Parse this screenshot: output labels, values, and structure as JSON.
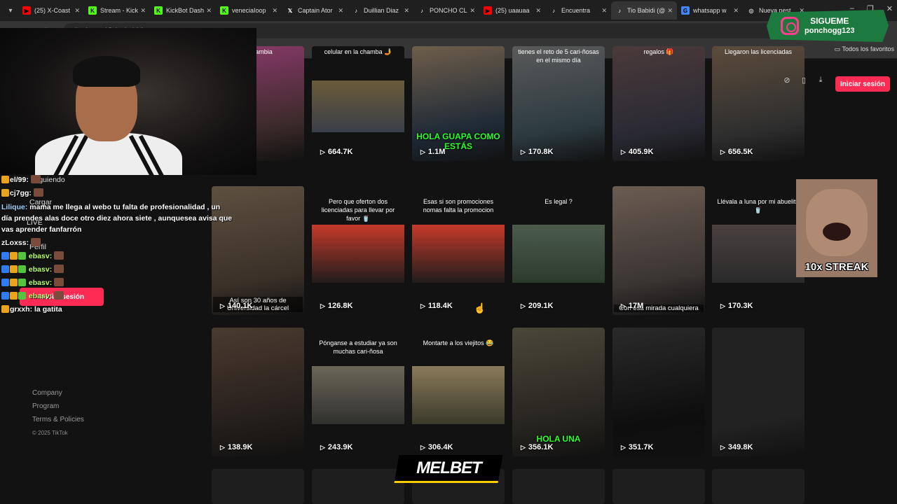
{
  "browser": {
    "tabs": [
      {
        "label": "(25) X-Coast",
        "icon": "youtube-icon",
        "color": "#ff0000"
      },
      {
        "label": "Stream - Kick",
        "icon": "kick-icon",
        "color": "#53fc18"
      },
      {
        "label": "KickBot Dash",
        "icon": "kick-icon",
        "color": "#53fc18"
      },
      {
        "label": "veneciaIoop",
        "icon": "kick-icon",
        "color": "#53fc18"
      },
      {
        "label": "Captain Ator",
        "icon": "x-icon",
        "color": "#ffffff"
      },
      {
        "label": "Duillian Diaz",
        "icon": "tiktok-icon",
        "color": "#ffffff"
      },
      {
        "label": "PONCHO CL",
        "icon": "tiktok-icon",
        "color": "#ffffff"
      },
      {
        "label": "(25) uaauaa",
        "icon": "youtube-icon",
        "color": "#ff0000"
      },
      {
        "label": "Encuentra",
        "icon": "tiktok-icon",
        "color": "#ffffff"
      },
      {
        "label": "Tio Babidi (@",
        "icon": "tiktok-icon",
        "color": "#ffffff"
      },
      {
        "label": "whatsapp w",
        "icon": "google-icon",
        "color": "#4285f4"
      },
      {
        "label": "Nueva pest",
        "icon": "globe-icon",
        "color": "#cccccc"
      }
    ],
    "url": "tiktok.com/@tio_babidi",
    "bookmarks_all": "Todos los favoritos"
  },
  "site": {
    "login_button": "Iniciar sesión",
    "footer_links": [
      "Company",
      "Program",
      "Terms & Policies"
    ],
    "copyright": "© 2025 TikTok"
  },
  "videos": [
    {
      "views": "",
      "caption": "no cambia",
      "overlay": "",
      "sub": ""
    },
    {
      "views": "664.7K",
      "caption": "celular en la chamba 🤳",
      "overlay": "",
      "sub": ""
    },
    {
      "views": "1.1M",
      "caption": "",
      "overlay": "HOLA GUAPA COMO ESTÁS",
      "sub": ""
    },
    {
      "views": "170.8K",
      "caption": "tienes el reto de 5 cari-ñosas en el mismo día",
      "overlay": "",
      "sub": ""
    },
    {
      "views": "405.9K",
      "caption": "regalos 🎁",
      "overlay": "",
      "sub": ""
    },
    {
      "views": "656.5K",
      "caption": "Llegaron las licenciadas",
      "overlay": "",
      "sub": ""
    },
    {
      "views": "140.1K",
      "caption": "",
      "overlay": "",
      "sub": "Así son 30 años de Universidad la cárcel"
    },
    {
      "views": "126.8K",
      "caption": "Pero que oferton dos licenciadas para llevar por favor 🥤",
      "overlay": "",
      "sub": ""
    },
    {
      "views": "118.4K",
      "caption": "Esas si son promociones nomas falta la promocion",
      "overlay": "",
      "sub": ""
    },
    {
      "views": "209.1K",
      "caption": "Es legal ?",
      "overlay": "",
      "sub": ""
    },
    {
      "views": "17M",
      "caption": "",
      "overlay": "",
      "sub": "Con esa mirada cualquiera"
    },
    {
      "views": "170.3K",
      "caption": "Llévala a luna por mi abuelito 🥤",
      "overlay": "",
      "sub": ""
    },
    {
      "views": "138.9K",
      "caption": "",
      "overlay": "",
      "sub": ""
    },
    {
      "views": "243.9K",
      "caption": "Pónganse a estudiar ya son muchas cari-ñosa",
      "overlay": "",
      "sub": ""
    },
    {
      "views": "306.4K",
      "caption": "Montarte a los viejitos 😂",
      "overlay": "",
      "sub": ""
    },
    {
      "views": "356.1K",
      "caption": "",
      "overlay": "HOLA UNA",
      "sub": ""
    },
    {
      "views": "351.7K",
      "caption": "",
      "overlay": "",
      "sub": ""
    },
    {
      "views": "349.8K",
      "caption": "",
      "overlay": "",
      "sub": ""
    }
  ],
  "chat": {
    "lines": [
      {
        "user": "el/99:",
        "text": ""
      },
      {
        "user": "cj7gg:",
        "text": ""
      },
      {
        "user": "Lilique:",
        "text": "mama me llega al webo tu falta de profesionalidad , un día prendes alas doce otro diez ahora siete , aunquesea avisa que vas aprender fanfarrón"
      },
      {
        "user": "zLoxss:",
        "text": ""
      },
      {
        "user": "ebasv:",
        "text": ""
      },
      {
        "user": "ebasv:",
        "text": ""
      },
      {
        "user": "ebasv:",
        "text": ""
      },
      {
        "user": "ebasv:",
        "text": ""
      },
      {
        "user": "grxxh:",
        "text": "la gatita"
      }
    ],
    "ghost_items": [
      "Siguiendo",
      "LIVE",
      "Cargar",
      "Perfil"
    ],
    "ghost_login": "Iniciar sesión"
  },
  "overlays": {
    "follow_title": "SIGUEME",
    "follow_user": "ponchogg123",
    "streak": "10x STREAK",
    "sponsor": "MELBET"
  },
  "colors": {
    "accent": "#fe2c55",
    "green": "#1d7a3e"
  }
}
